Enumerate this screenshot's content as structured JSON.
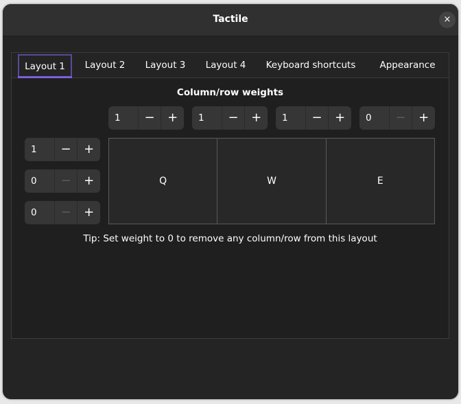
{
  "window": {
    "title": "Tactile",
    "close_icon": "×"
  },
  "tabs": [
    {
      "label": "Layout 1",
      "active": true
    },
    {
      "label": "Layout 2",
      "active": false
    },
    {
      "label": "Layout 3",
      "active": false
    },
    {
      "label": "Layout 4",
      "active": false
    },
    {
      "label": "Keyboard shortcuts",
      "active": false
    },
    {
      "label": "Appearance",
      "active": false
    }
  ],
  "layout": {
    "section_title": "Column/row weights",
    "minus_icon": "−",
    "plus_icon": "+",
    "column_weights": [
      "1",
      "1",
      "1",
      "0"
    ],
    "row_weights": [
      "1",
      "0",
      "0"
    ],
    "cells": [
      "Q",
      "W",
      "E"
    ],
    "tip": "Tip: Set weight to 0 to remove any column/row from this layout"
  },
  "colors": {
    "accent": "#7b61d8",
    "background": "#242424"
  }
}
